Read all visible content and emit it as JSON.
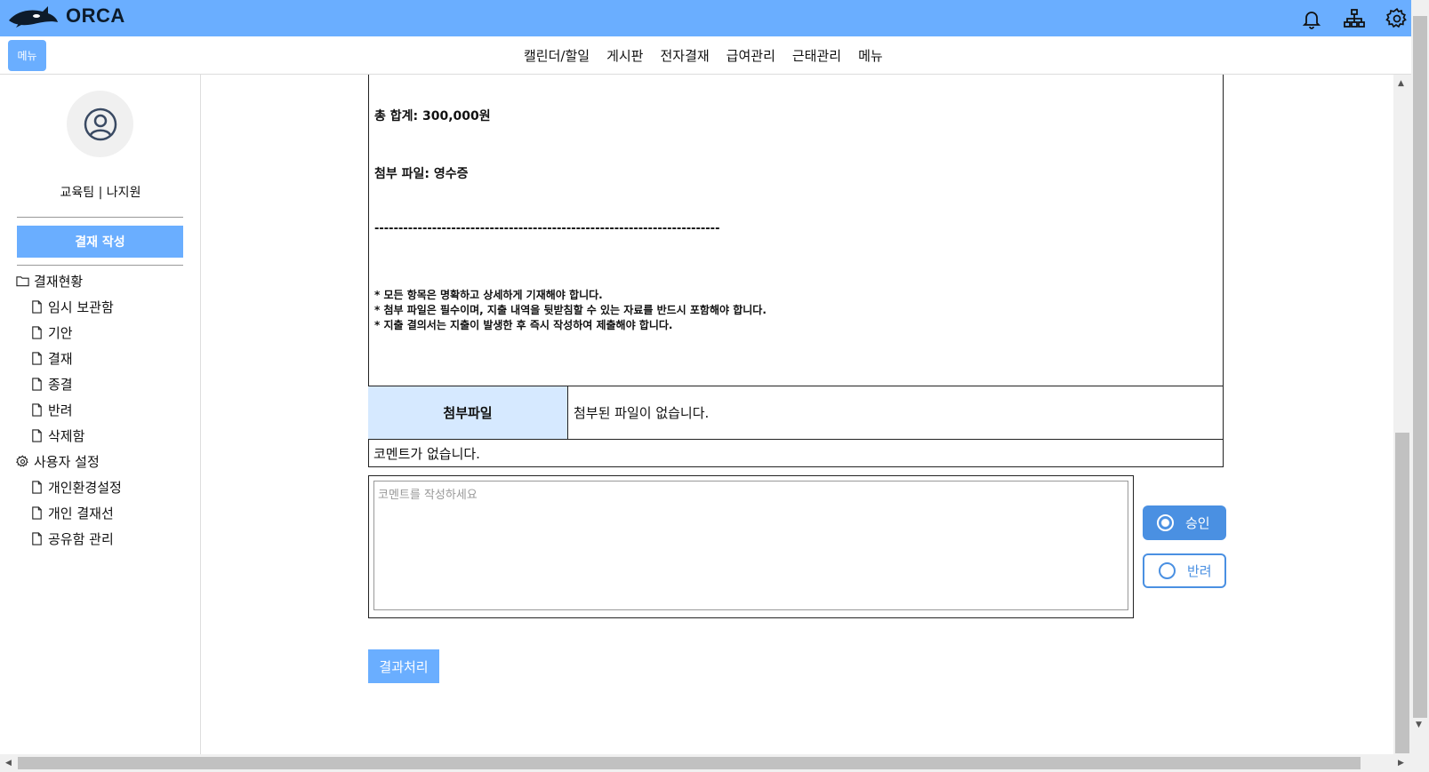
{
  "app": {
    "name": "ORCA"
  },
  "nav": {
    "menu_button": "메뉴",
    "links": [
      "캘린더/할일",
      "게시판",
      "전자결재",
      "급여관리",
      "근태관리",
      "메뉴"
    ]
  },
  "sidebar": {
    "user": "교육팀 | 나지원",
    "write_button": "결재 작성",
    "tree": [
      {
        "label": "결재현황",
        "icon": "folder-icon",
        "child": false
      },
      {
        "label": "임시 보관함",
        "icon": "file-icon",
        "child": true
      },
      {
        "label": "기안",
        "icon": "file-icon",
        "child": true
      },
      {
        "label": "결재",
        "icon": "file-icon",
        "child": true
      },
      {
        "label": "종결",
        "icon": "file-icon",
        "child": true
      },
      {
        "label": "반려",
        "icon": "file-icon",
        "child": true
      },
      {
        "label": "삭제함",
        "icon": "file-icon",
        "child": true
      },
      {
        "label": "사용자 설정",
        "icon": "gear-icon",
        "child": false
      },
      {
        "label": "개인환경설정",
        "icon": "file-icon",
        "child": true
      },
      {
        "label": "개인 결재선",
        "icon": "file-icon",
        "child": true
      },
      {
        "label": "공유함 관리",
        "icon": "file-icon",
        "child": true
      }
    ]
  },
  "document": {
    "total": "총 합계: 300,000원",
    "attachment_line": "첨부 파일: 영수증",
    "divider": "------------------------------------------------------------------------",
    "notes": [
      "* 모든 항목은 명확하고 상세하게 기재해야 합니다.",
      "* 첨부 파일은 필수이며, 지출 내역을 뒷받침할 수 있는 자료를 반드시 포함해야 합니다.",
      "* 지출 결의서는 지출이 발생한 후 즉시 작성하여 제출해야 합니다."
    ],
    "attach_label": "첨부파일",
    "attach_value": "첨부된 파일이 없습니다.",
    "comment_value": "코멘트가 없습니다."
  },
  "comment_input": {
    "placeholder": "코멘트를 작성하세요",
    "value": ""
  },
  "decision": {
    "approve": "승인",
    "reject": "반려",
    "selected": "approve"
  },
  "result_button": "결과처리",
  "colors": {
    "header": "#6aaeff",
    "accent": "#4a90e2",
    "attach_bg": "#d6e9ff"
  }
}
